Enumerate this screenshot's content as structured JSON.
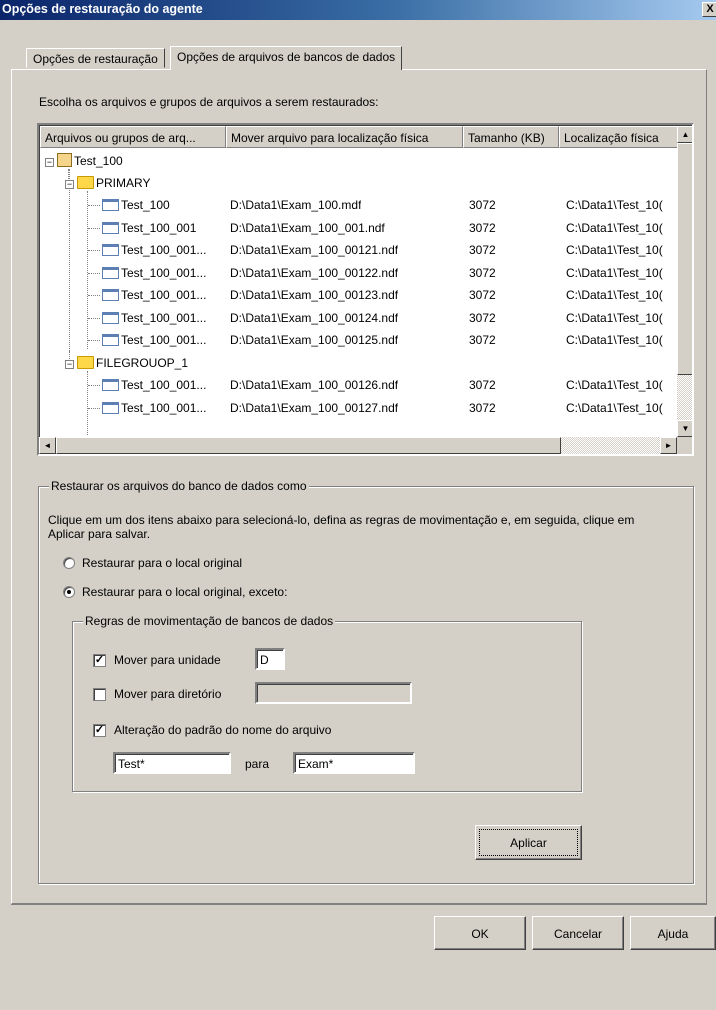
{
  "window": {
    "title": "Opções de restauração do agente",
    "close_glyph": "X"
  },
  "tabs": [
    {
      "label": "Opções de restauração"
    },
    {
      "label": "Opções de arquivos de bancos de dados"
    }
  ],
  "choose_label": "Escolha os arquivos e grupos de arquivos a serem restaurados:",
  "filelist": {
    "columns": [
      "Arquivos ou grupos de arq...",
      "Mover arquivo para localização física",
      "Tamanho (KB)",
      "Localização física"
    ],
    "root": {
      "name": "Test_100",
      "expander": "−"
    },
    "groups": [
      {
        "name": "PRIMARY",
        "expander": "−"
      },
      {
        "name": "FILEGROUOP_1",
        "expander": "−"
      }
    ],
    "rows": [
      {
        "name": "Test_100",
        "move_to": "D:\\Data1\\Exam_100.mdf",
        "size": "3072",
        "location": "C:\\Data1\\Test_10("
      },
      {
        "name": "Test_100_001",
        "move_to": "D:\\Data1\\Exam_100_001.ndf",
        "size": "3072",
        "location": "C:\\Data1\\Test_10("
      },
      {
        "name": "Test_100_001...",
        "move_to": "D:\\Data1\\Exam_100_00121.ndf",
        "size": "3072",
        "location": "C:\\Data1\\Test_10("
      },
      {
        "name": "Test_100_001...",
        "move_to": "D:\\Data1\\Exam_100_00122.ndf",
        "size": "3072",
        "location": "C:\\Data1\\Test_10("
      },
      {
        "name": "Test_100_001...",
        "move_to": "D:\\Data1\\Exam_100_00123.ndf",
        "size": "3072",
        "location": "C:\\Data1\\Test_10("
      },
      {
        "name": "Test_100_001...",
        "move_to": "D:\\Data1\\Exam_100_00124.ndf",
        "size": "3072",
        "location": "C:\\Data1\\Test_10("
      },
      {
        "name": "Test_100_001...",
        "move_to": "D:\\Data1\\Exam_100_00125.ndf",
        "size": "3072",
        "location": "C:\\Data1\\Test_10("
      },
      {
        "name": "Test_100_001...",
        "move_to": "D:\\Data1\\Exam_100_00126.ndf",
        "size": "3072",
        "location": "C:\\Data1\\Test_10("
      },
      {
        "name": "Test_100_001...",
        "move_to": "D:\\Data1\\Exam_100_00127.ndf",
        "size": "3072",
        "location": "C:\\Data1\\Test_10("
      }
    ],
    "scroll_up": "▲",
    "scroll_down": "▼",
    "scroll_left": "◄",
    "scroll_right": "►"
  },
  "restore_group": {
    "label": "Restaurar os arquivos do banco de dados como",
    "instructions": "Clique em um dos itens abaixo para selecioná-lo, defina as regras de movimentação e, em seguida, clique em Aplicar para salvar.",
    "radio_original": "Restaurar para o local original",
    "radio_except": "Restaurar para o local original, exceto:",
    "selected": "except"
  },
  "rules_group": {
    "label": "Regras de movimentação de bancos de dados",
    "move_drive": {
      "label": "Mover para unidade",
      "checked": true,
      "value": "D"
    },
    "move_dir": {
      "label": "Mover para diretório",
      "checked": false,
      "value": ""
    },
    "rename": {
      "label": "Alteração do padrão do nome do arquivo",
      "checked": true,
      "from": "Test*",
      "to_label": "para",
      "to": "Exam*"
    },
    "check_glyph": "✓"
  },
  "buttons": {
    "apply": "Aplicar",
    "ok": "OK",
    "cancel": "Cancelar",
    "help": "Ajuda"
  }
}
